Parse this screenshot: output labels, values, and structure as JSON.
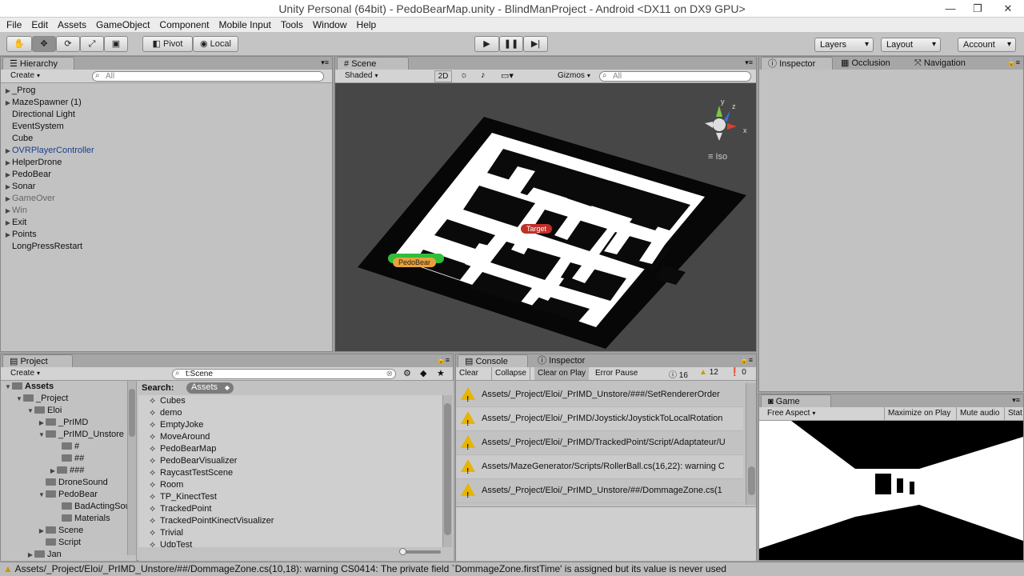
{
  "window": {
    "title": "Unity Personal (64bit) - PedoBearMap.unity - BlindManProject - Android <DX11 on DX9 GPU>",
    "minimize": "—",
    "maximize": "❐",
    "close": "✕"
  },
  "menu": [
    "File",
    "Edit",
    "Assets",
    "GameObject",
    "Component",
    "Mobile Input",
    "Tools",
    "Window",
    "Help"
  ],
  "toolbar": {
    "pivot": "Pivot",
    "local": "Local",
    "play": "▶",
    "pause": "❚❚",
    "step": "▶|",
    "layers": "Layers",
    "layout": "Layout",
    "account": "Account"
  },
  "hierarchy": {
    "tab": "Hierarchy",
    "create": "Create",
    "search_placeholder": "All",
    "items": [
      {
        "label": "_Prog",
        "expand": "▶",
        "color": "#111"
      },
      {
        "label": "MazeSpawner (1)",
        "expand": "▶",
        "color": "#111"
      },
      {
        "label": "Directional Light",
        "expand": "",
        "color": "#111"
      },
      {
        "label": "EventSystem",
        "expand": "",
        "color": "#111"
      },
      {
        "label": "Cube",
        "expand": "",
        "color": "#111"
      },
      {
        "label": "OVRPlayerController",
        "expand": "▶",
        "color": "#1d3f8a"
      },
      {
        "label": "HelperDrone",
        "expand": "▶",
        "color": "#111"
      },
      {
        "label": "PedoBear",
        "expand": "▶",
        "color": "#111"
      },
      {
        "label": "Sonar",
        "expand": "▶",
        "color": "#111"
      },
      {
        "label": "GameOver",
        "expand": "▶",
        "color": "#666"
      },
      {
        "label": "Win",
        "expand": "▶",
        "color": "#666"
      },
      {
        "label": "Exit",
        "expand": "▶",
        "color": "#111"
      },
      {
        "label": "Points",
        "expand": "▶",
        "color": "#111"
      },
      {
        "label": "LongPressRestart",
        "expand": "",
        "color": "#111"
      }
    ]
  },
  "scene": {
    "tab": "Scene",
    "shading": "Shaded",
    "mode2d": "2D",
    "gizmos": "Gizmos",
    "search_placeholder": "All",
    "projection": "Iso",
    "axis_x": "x",
    "axis_y": "y",
    "axis_z": "z",
    "label_target": "Target",
    "label_pedobear": "PedoBear"
  },
  "inspector": {
    "tab": "Inspector",
    "tab_occlusion": "Occlusion",
    "tab_navigation": "Navigation"
  },
  "project": {
    "tab": "Project",
    "create": "Create",
    "search_value": "t:Scene",
    "search_label": "Search:",
    "search_scope": "Assets",
    "tree": [
      {
        "label": "Assets",
        "expand": "▼",
        "bold": true
      },
      {
        "label": "_Project",
        "expand": "▼",
        "bold": false
      },
      {
        "label": "Eloi",
        "expand": "▼",
        "bold": false
      },
      {
        "label": "_PrIMD",
        "expand": "▶",
        "bold": false
      },
      {
        "label": "_PrIMD_Unstore",
        "expand": "▼",
        "bold": false
      },
      {
        "label": "#",
        "expand": "",
        "bold": false
      },
      {
        "label": "##",
        "expand": "",
        "bold": false
      },
      {
        "label": "###",
        "expand": "▶",
        "bold": false
      },
      {
        "label": "DroneSound",
        "expand": "",
        "bold": false
      },
      {
        "label": "PedoBear",
        "expand": "▼",
        "bold": false
      },
      {
        "label": "BadActingSou",
        "expand": "",
        "bold": false
      },
      {
        "label": "Materials",
        "expand": "",
        "bold": false
      },
      {
        "label": "Scene",
        "expand": "▶",
        "bold": false
      },
      {
        "label": "Script",
        "expand": "",
        "bold": false
      },
      {
        "label": "Jan",
        "expand": "▶",
        "bold": false
      }
    ],
    "results": [
      "Cubes",
      "demo",
      "EmptyJoke",
      "MoveAround",
      "PedoBearMap",
      "PedoBearVisualizer",
      "RaycastTestScene",
      "Room",
      "TP_KinectTest",
      "TrackedPoint",
      "TrackedPointKinectVisualizer",
      "Trivial",
      "UdpTest"
    ]
  },
  "console": {
    "tab": "Console",
    "tab_inspector": "Inspector",
    "clear": "Clear",
    "collapse": "Collapse",
    "clear_on_play": "Clear on Play",
    "error_pause": "Error Pause",
    "count_info": "16",
    "count_warn": "12",
    "count_error": "0",
    "entries": [
      "Assets/_Project/Eloi/_PrIMD_Unstore/###/SetRendererOrder",
      "Assets/_Project/Eloi/_PrIMD/Joystick/JoystickToLocalRotation",
      "Assets/_Project/Eloi/_PrIMD/TrackedPoint/Script/Adaptateur/U",
      "Assets/MazeGenerator/Scripts/RollerBall.cs(16,22): warning C",
      "Assets/_Project/Eloi/_PrIMD_Unstore/##/DommageZone.cs(1"
    ]
  },
  "game": {
    "tab": "Game",
    "aspect": "Free Aspect",
    "maximize": "Maximize on Play",
    "mute": "Mute audio",
    "stats": "Stat"
  },
  "status": {
    "message": "Assets/_Project/Eloi/_PrIMD_Unstore/##/DommageZone.cs(10,18): warning CS0414: The private field `DommageZone.firstTime' is assigned but its value is never used"
  },
  "colors": {
    "hierarchy_highlight": "#1d3f8a",
    "target_label": "#c0302a",
    "pedobear_label": "#e9a23b",
    "scene_bg": "#474747",
    "warning": "#e8b400"
  }
}
